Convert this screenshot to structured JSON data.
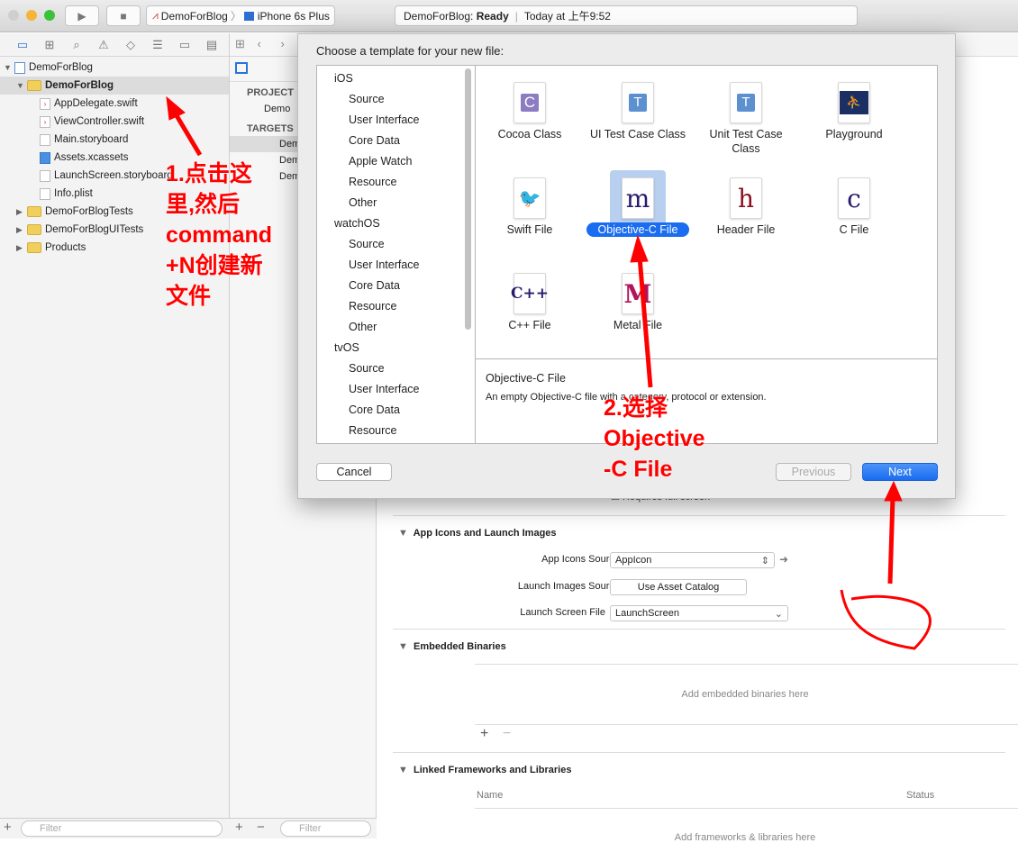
{
  "toolbar": {
    "scheme": "DemoForBlog",
    "device": "iPhone 6s Plus",
    "status_project": "DemoForBlog:",
    "status_state": "Ready",
    "status_time": "Today at 上午9:52"
  },
  "navigator": {
    "items": [
      {
        "label": "DemoForBlog",
        "level": 0,
        "kind": "project"
      },
      {
        "label": "DemoForBlog",
        "level": 1,
        "kind": "folder",
        "selected": true
      },
      {
        "label": "AppDelegate.swift",
        "level": 2,
        "kind": "swift"
      },
      {
        "label": "ViewController.swift",
        "level": 2,
        "kind": "swift"
      },
      {
        "label": "Main.storyboard",
        "level": 2,
        "kind": "storyboard"
      },
      {
        "label": "Assets.xcassets",
        "level": 2,
        "kind": "assets"
      },
      {
        "label": "LaunchScreen.storyboard",
        "level": 2,
        "kind": "storyboard"
      },
      {
        "label": "Info.plist",
        "level": 2,
        "kind": "plist"
      },
      {
        "label": "DemoForBlogTests",
        "level": 1,
        "kind": "folder"
      },
      {
        "label": "DemoForBlogUITests",
        "level": 1,
        "kind": "folder"
      },
      {
        "label": "Products",
        "level": 1,
        "kind": "folder"
      }
    ],
    "filter_placeholder": "Filter"
  },
  "middle": {
    "project_header": "PROJECT",
    "project_item": "Demo",
    "targets_header": "TARGETS",
    "targets": [
      "Demo",
      "Demo",
      "Demo"
    ],
    "filter_placeholder": "Filter"
  },
  "editor": {
    "requires_full_screen": "Requires full screen",
    "app_icons_section": "App Icons and Launch Images",
    "app_icons_source_label": "App Icons Source",
    "app_icons_source_value": "AppIcon",
    "launch_images_source_label": "Launch Images Source",
    "launch_images_button": "Use Asset Catalog",
    "launch_screen_label": "Launch Screen File",
    "launch_screen_value": "LaunchScreen",
    "embedded_section": "Embedded Binaries",
    "embedded_empty": "Add embedded binaries here",
    "linked_section": "Linked Frameworks and Libraries",
    "col_name": "Name",
    "col_status": "Status",
    "linked_empty": "Add frameworks & libraries here"
  },
  "sheet": {
    "title": "Choose a template for your new file:",
    "categories": [
      {
        "label": "iOS",
        "header": true
      },
      {
        "label": "Source"
      },
      {
        "label": "User Interface"
      },
      {
        "label": "Core Data"
      },
      {
        "label": "Apple Watch"
      },
      {
        "label": "Resource"
      },
      {
        "label": "Other"
      },
      {
        "label": "watchOS",
        "header": true
      },
      {
        "label": "Source"
      },
      {
        "label": "User Interface"
      },
      {
        "label": "Core Data"
      },
      {
        "label": "Resource"
      },
      {
        "label": "Other"
      },
      {
        "label": "tvOS",
        "header": true
      },
      {
        "label": "Source"
      },
      {
        "label": "User Interface"
      },
      {
        "label": "Core Data"
      },
      {
        "label": "Resource"
      }
    ],
    "templates": [
      {
        "label": "Cocoa Class",
        "glyph": "C"
      },
      {
        "label": "UI Test Case Class",
        "glyph": "T"
      },
      {
        "label": "Unit Test Case Class",
        "glyph": "T"
      },
      {
        "label": "Playground",
        "glyph": "⛹"
      },
      {
        "label": "Swift File",
        "glyph": "🐦"
      },
      {
        "label": "Objective-C File",
        "glyph": "m",
        "selected": true
      },
      {
        "label": "Header File",
        "glyph": "h"
      },
      {
        "label": "C File",
        "glyph": "c"
      },
      {
        "label": "C++ File",
        "glyph": "C++"
      },
      {
        "label": "Metal File",
        "glyph": "M"
      }
    ],
    "desc_title": "Objective-C File",
    "desc_text": "An empty Objective-C file with a category, protocol or extension.",
    "cancel": "Cancel",
    "previous": "Previous",
    "next": "Next",
    "accent": "#1a6cf0"
  },
  "annotations": {
    "step1": "1.点击这里,然后command+N创建新文件",
    "step1_lines": [
      "1.点击这",
      "里,然后",
      "command",
      "+N创建新",
      "文件"
    ],
    "step2_lines": [
      "2.选择",
      "Objective",
      "-C File"
    ],
    "color": "#ff0000"
  }
}
